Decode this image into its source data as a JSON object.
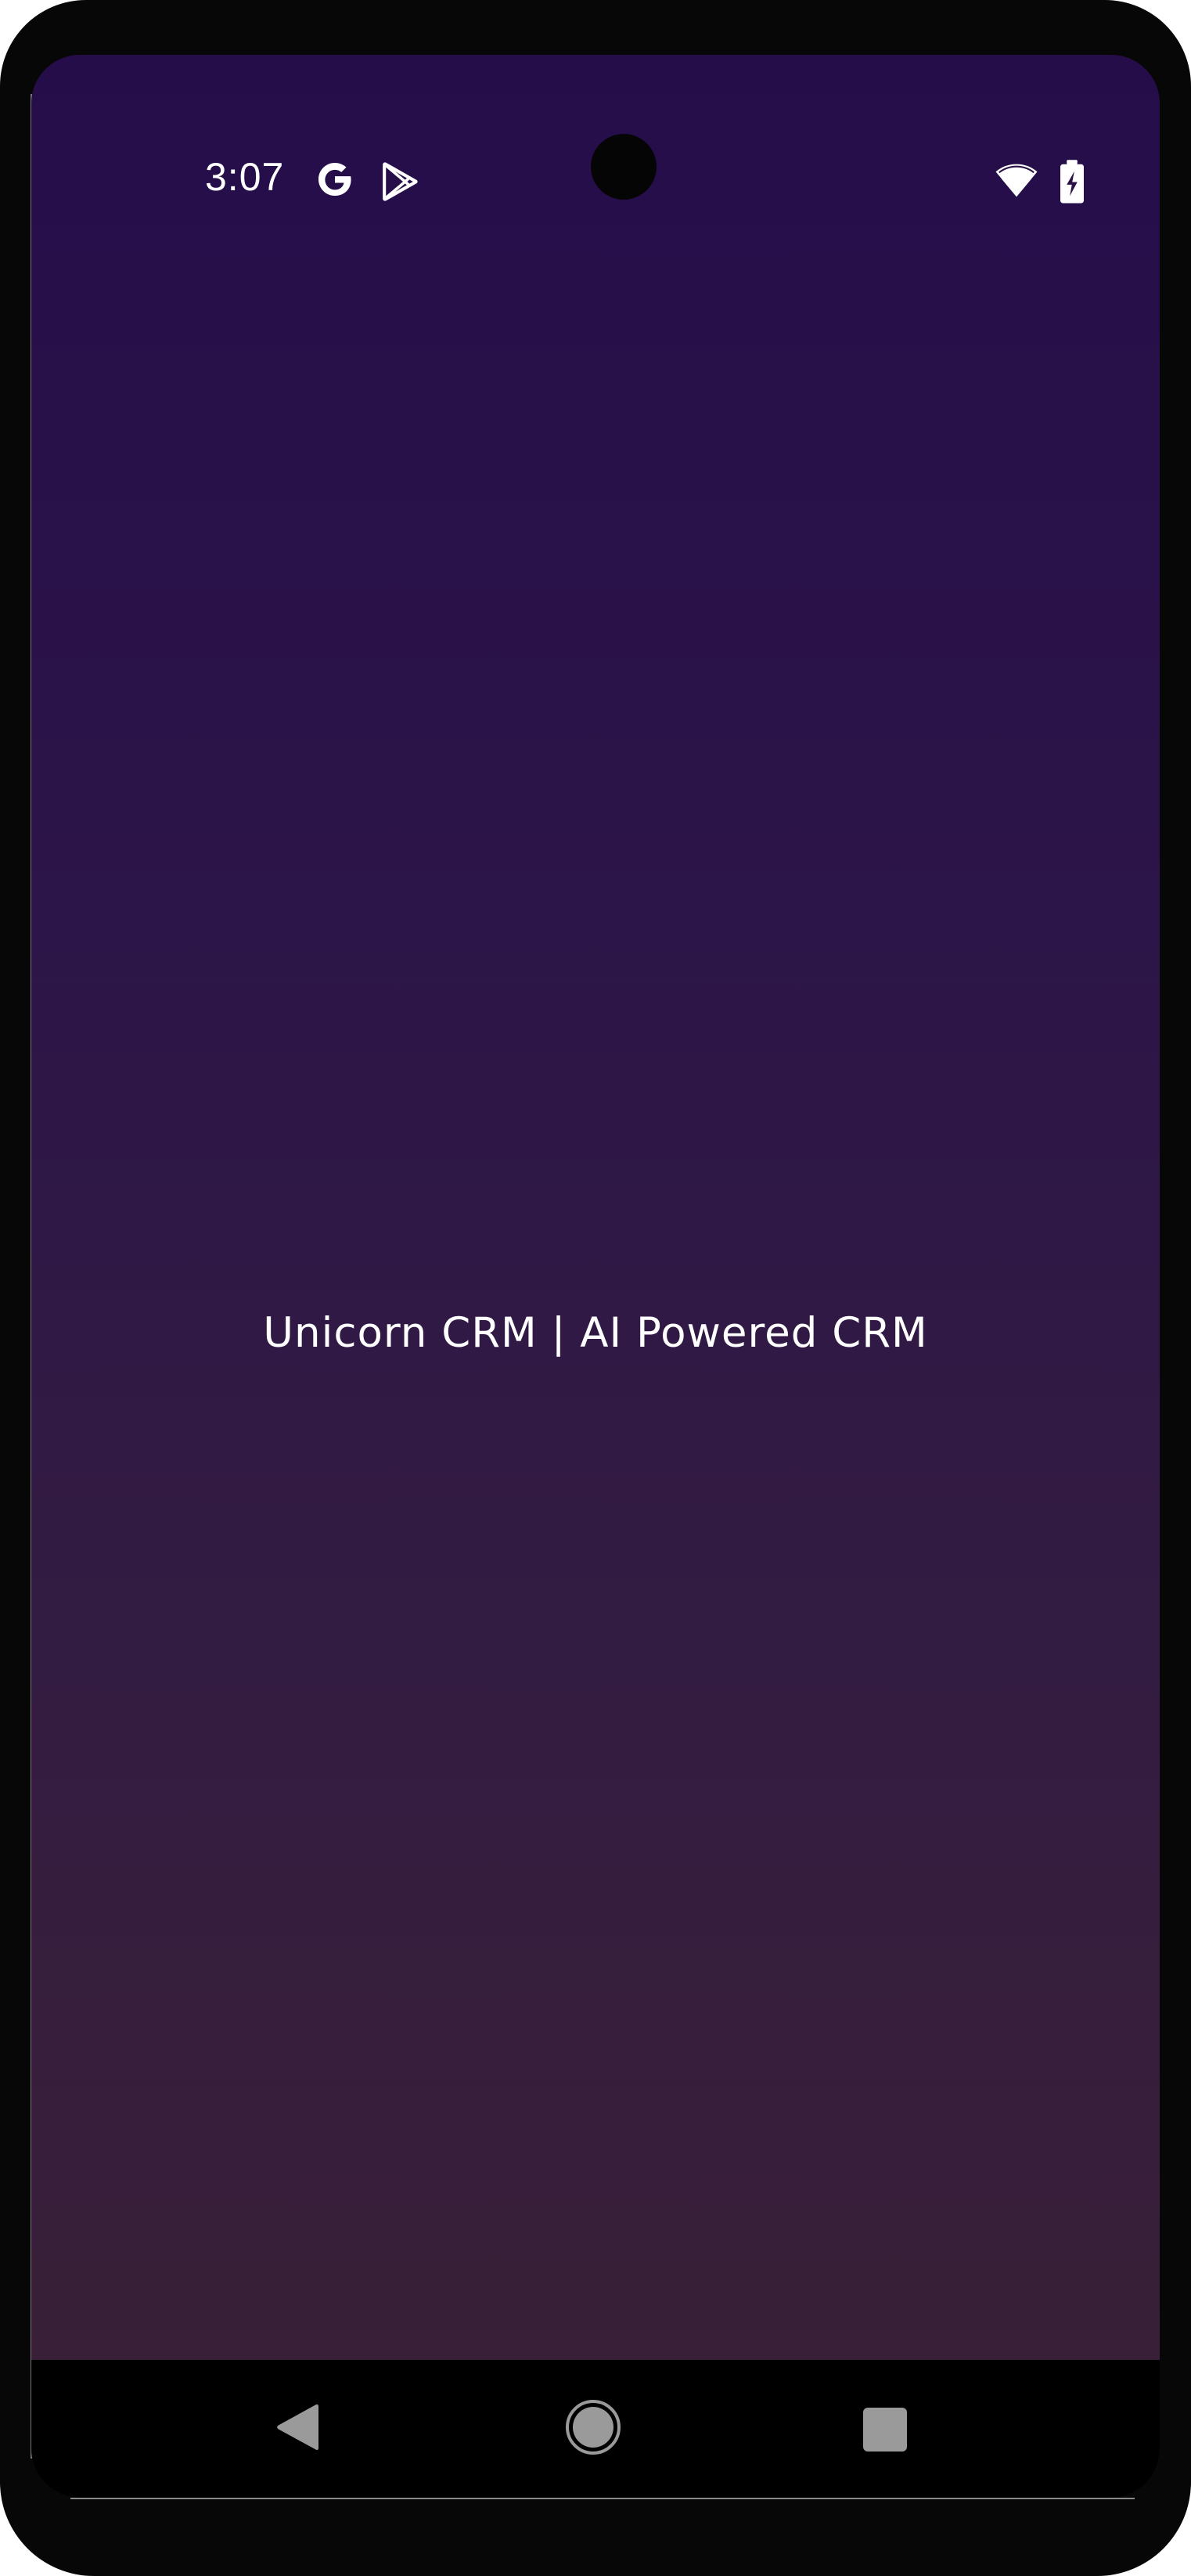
{
  "status_bar": {
    "time": "3:07",
    "notification_icons": [
      "google-g-icon",
      "play-store-icon"
    ],
    "system_icons": [
      "wifi-icon",
      "battery-charging-icon"
    ]
  },
  "main": {
    "title": "Unicorn CRM | AI Powered CRM"
  },
  "nav_bar": {
    "buttons": [
      "back-icon",
      "home-icon",
      "recents-icon"
    ]
  },
  "colors": {
    "background_top": "#250d4a",
    "background_bottom": "#3a2035",
    "text": "#ffffff",
    "nav_bar": "#000000",
    "device_frame": "#070707"
  }
}
